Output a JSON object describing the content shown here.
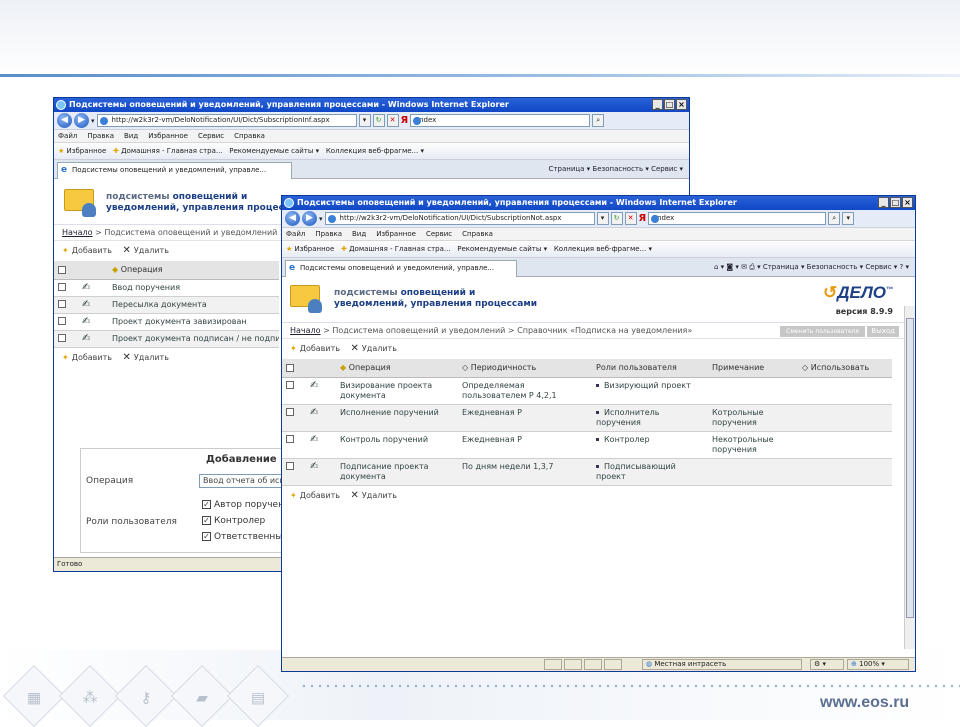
{
  "slide": {
    "footer_url": "www.eos.ru"
  },
  "back_window": {
    "title": "Подсистемы оповещений и уведомлений, управления процессами - Windows Internet Explorer",
    "address": "http://w2k3r2-vm/DeloNotification/UI/Dict/SubscriptionInf.aspx",
    "search": "Яndex",
    "menu": [
      "Файл",
      "Правка",
      "Вид",
      "Избранное",
      "Сервис",
      "Справка"
    ],
    "favorites": "Избранное",
    "fav_links": [
      "Домашняя - Главная стра...",
      "Рекомендуемые сайты",
      "Коллекция веб-фрагме..."
    ],
    "tab": "Подсистемы оповещений и уведомлений, управле...",
    "tools": "Страница ▾  Безопасность ▾  Сервис ▾",
    "banner_line1_a": "подсистемы ",
    "banner_line1_b": "оповещений и",
    "banner_line2": "уведомлений, управления процессами",
    "crumb_home": "Начало",
    "crumb_rest": " > Подсистема оповещений и уведомлений > Справочник «Подписка на уведомления»",
    "add": "Добавить",
    "del": "Удалить",
    "col_op": "Операция",
    "rows": [
      "Ввод поручения",
      "Пересылка документа",
      "Проект документа завизирован",
      "Проект документа подписан / не подписан"
    ],
    "form_title": "Добавление",
    "op_label": "Операция",
    "op_value": "Ввод отчета об исполнении",
    "roles_label": "Роли пользователя",
    "roles": [
      "Автор поручения",
      "Контролер",
      "Ответственный исполнитель"
    ],
    "status": "Готово"
  },
  "front_window": {
    "title": "Подсистемы оповещений и уведомлений, управления процессами - Windows Internet Explorer",
    "address": "http://w2k3r2-vm/DeloNotification/UI/Dict/SubscriptionNot.aspx",
    "search": "Яndex",
    "menu": [
      "Файл",
      "Правка",
      "Вид",
      "Избранное",
      "Сервис",
      "Справка"
    ],
    "favorites": "Избранное",
    "fav_links": [
      "Домашняя - Главная стра...",
      "Рекомендуемые сайты",
      "Коллекция веб-фрагме..."
    ],
    "tab": "Подсистемы оповещений и уведомлений, управле...",
    "tools": "Страница ▾  Безопасность ▾  Сервис ▾",
    "banner_line1_a": "подсистемы ",
    "banner_line1_b": "оповещений и",
    "banner_line2": "уведомлений, управления процессами",
    "brand": "ДЕЛО",
    "brand_tm": "™",
    "version": "версия 8.9.9",
    "crumb_home": "Начало",
    "crumb_rest": " > Подсистема оповещений и уведомлений > Справочник «Подписка на уведомления»",
    "change_user": "Сменить пользователя",
    "exit": "Выход",
    "add": "Добавить",
    "del": "Удалить",
    "columns": {
      "op": "Операция",
      "period": "Периодичность",
      "roles": "Роли пользователя",
      "note": "Примечание",
      "use": "Использовать"
    },
    "rows": [
      {
        "op": "Визирование проекта документа",
        "period": "Определяемая пользователем Р 4,2,1",
        "role": "Визирующий проект",
        "note": ""
      },
      {
        "op": "Исполнение поручений",
        "period": "Ежедневная Р",
        "role": "Исполнитель поручения",
        "note": "Котрольные поручения"
      },
      {
        "op": "Контроль поручений",
        "period": "Ежедневная Р",
        "role": "Контролер",
        "note": "Некотрольные поручения"
      },
      {
        "op": "Подписание проекта документа",
        "period": "По дням недели 1,3,7",
        "role": "Подписывающий проект",
        "note": ""
      }
    ],
    "zone": "Местная интрасеть",
    "zoom": "100%"
  }
}
